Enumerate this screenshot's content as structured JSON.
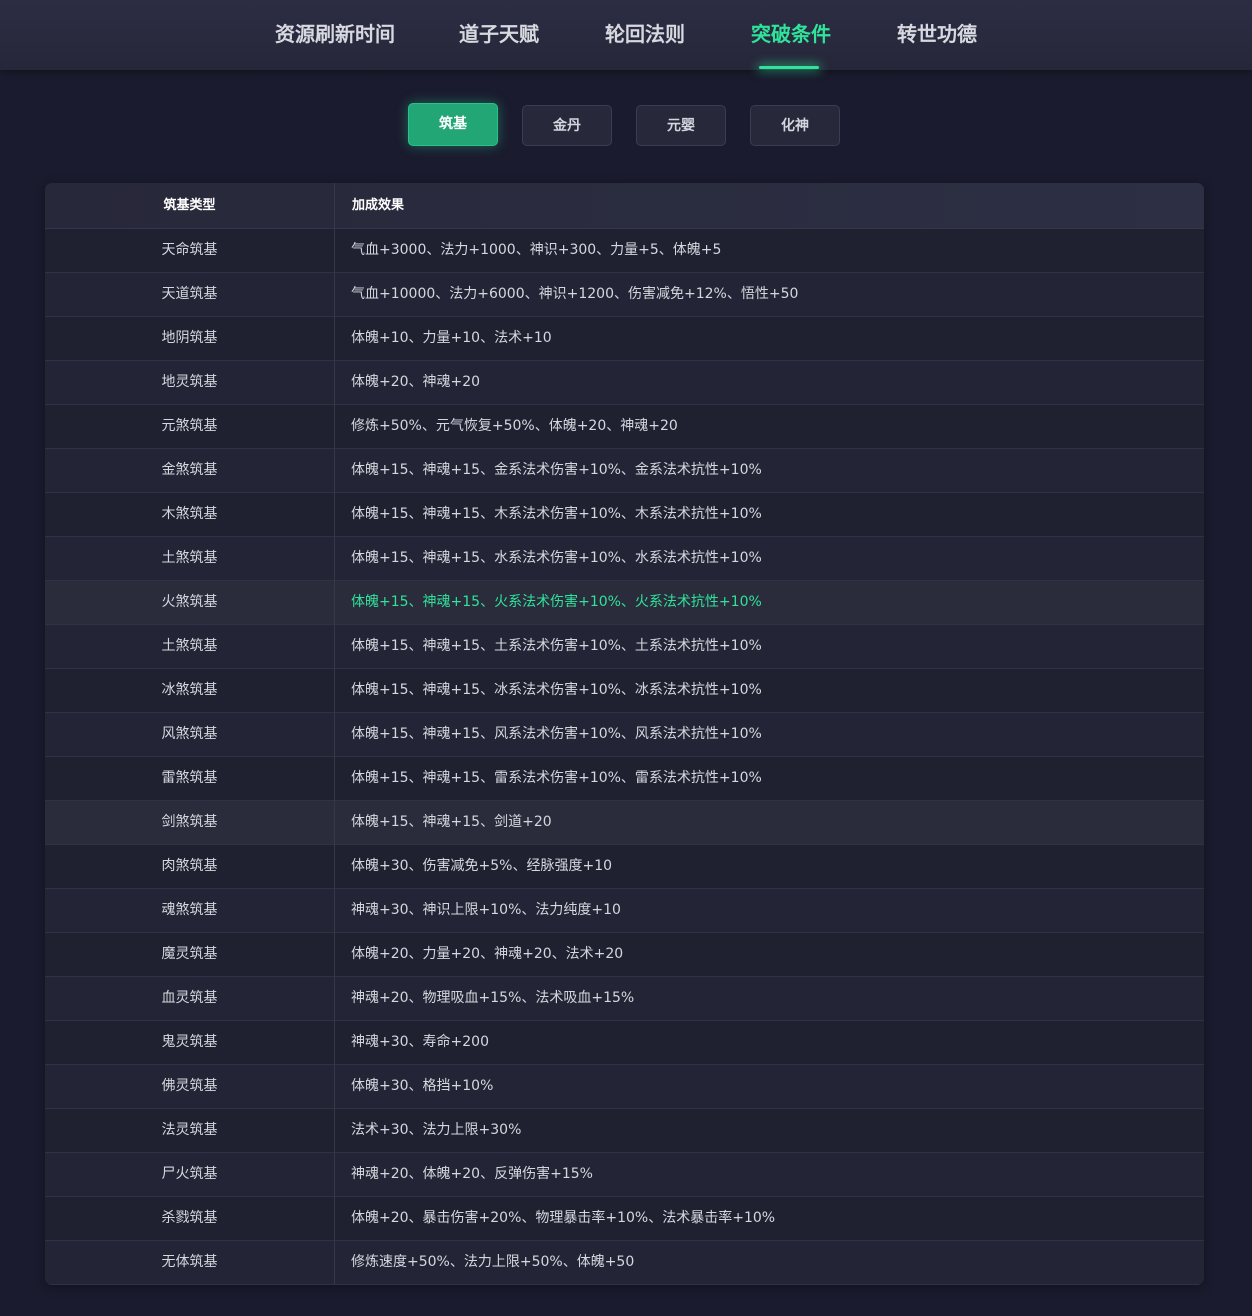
{
  "nav": {
    "items": [
      {
        "label": "资源刷新时间"
      },
      {
        "label": "道子天赋"
      },
      {
        "label": "轮回法则"
      },
      {
        "label": "突破条件"
      },
      {
        "label": "转世功德"
      }
    ],
    "active_index": 3
  },
  "subtabs": {
    "items": [
      {
        "label": "筑基"
      },
      {
        "label": "金丹"
      },
      {
        "label": "元婴"
      },
      {
        "label": "化神"
      }
    ],
    "active_index": 0
  },
  "table": {
    "headers": {
      "type": "筑基类型",
      "effect": "加成效果"
    },
    "rows": [
      {
        "type": "天命筑基",
        "effect": "气血+3000、法力+1000、神识+300、力量+5、体魄+5"
      },
      {
        "type": "天道筑基",
        "effect": "气血+10000、法力+6000、神识+1200、伤害减免+12%、悟性+50"
      },
      {
        "type": "地阴筑基",
        "effect": "体魄+10、力量+10、法术+10"
      },
      {
        "type": "地灵筑基",
        "effect": "体魄+20、神魂+20"
      },
      {
        "type": "元煞筑基",
        "effect": "修炼+50%、元气恢复+50%、体魄+20、神魂+20"
      },
      {
        "type": "金煞筑基",
        "effect": "体魄+15、神魂+15、金系法术伤害+10%、金系法术抗性+10%"
      },
      {
        "type": "木煞筑基",
        "effect": "体魄+15、神魂+15、木系法术伤害+10%、木系法术抗性+10%"
      },
      {
        "type": "土煞筑基",
        "effect": "体魄+15、神魂+15、水系法术伤害+10%、水系法术抗性+10%"
      },
      {
        "type": "火煞筑基",
        "effect": "体魄+15、神魂+15、火系法术伤害+10%、火系法术抗性+10%",
        "highlight": true
      },
      {
        "type": "土煞筑基",
        "effect": "体魄+15、神魂+15、土系法术伤害+10%、土系法术抗性+10%"
      },
      {
        "type": "冰煞筑基",
        "effect": "体魄+15、神魂+15、冰系法术伤害+10%、冰系法术抗性+10%"
      },
      {
        "type": "风煞筑基",
        "effect": "体魄+15、神魂+15、风系法术伤害+10%、风系法术抗性+10%"
      },
      {
        "type": "雷煞筑基",
        "effect": "体魄+15、神魂+15、雷系法术伤害+10%、雷系法术抗性+10%"
      },
      {
        "type": "剑煞筑基",
        "effect": "体魄+15、神魂+15、剑道+20"
      },
      {
        "type": "肉煞筑基",
        "effect": "体魄+30、伤害减免+5%、经脉强度+10"
      },
      {
        "type": "魂煞筑基",
        "effect": "神魂+30、神识上限+10%、法力纯度+10"
      },
      {
        "type": "魔灵筑基",
        "effect": "体魄+20、力量+20、神魂+20、法术+20"
      },
      {
        "type": "血灵筑基",
        "effect": "神魂+20、物理吸血+15%、法术吸血+15%"
      },
      {
        "type": "鬼灵筑基",
        "effect": "神魂+30、寿命+200"
      },
      {
        "type": "佛灵筑基",
        "effect": "体魄+30、格挡+10%"
      },
      {
        "type": "法灵筑基",
        "effect": "法术+30、法力上限+30%"
      },
      {
        "type": "尸火筑基",
        "effect": "神魂+20、体魄+20、反弹伤害+15%"
      },
      {
        "type": "杀戮筑基",
        "effect": "体魄+20、暴击伤害+20%、物理暴击率+10%、法术暴击率+10%"
      },
      {
        "type": "无体筑基",
        "effect": "修炼速度+50%、法力上限+50%、体魄+50"
      }
    ]
  },
  "colors": {
    "accent": "#2fe39a",
    "active_button": "#23a676",
    "background": "#1a1b2e"
  }
}
